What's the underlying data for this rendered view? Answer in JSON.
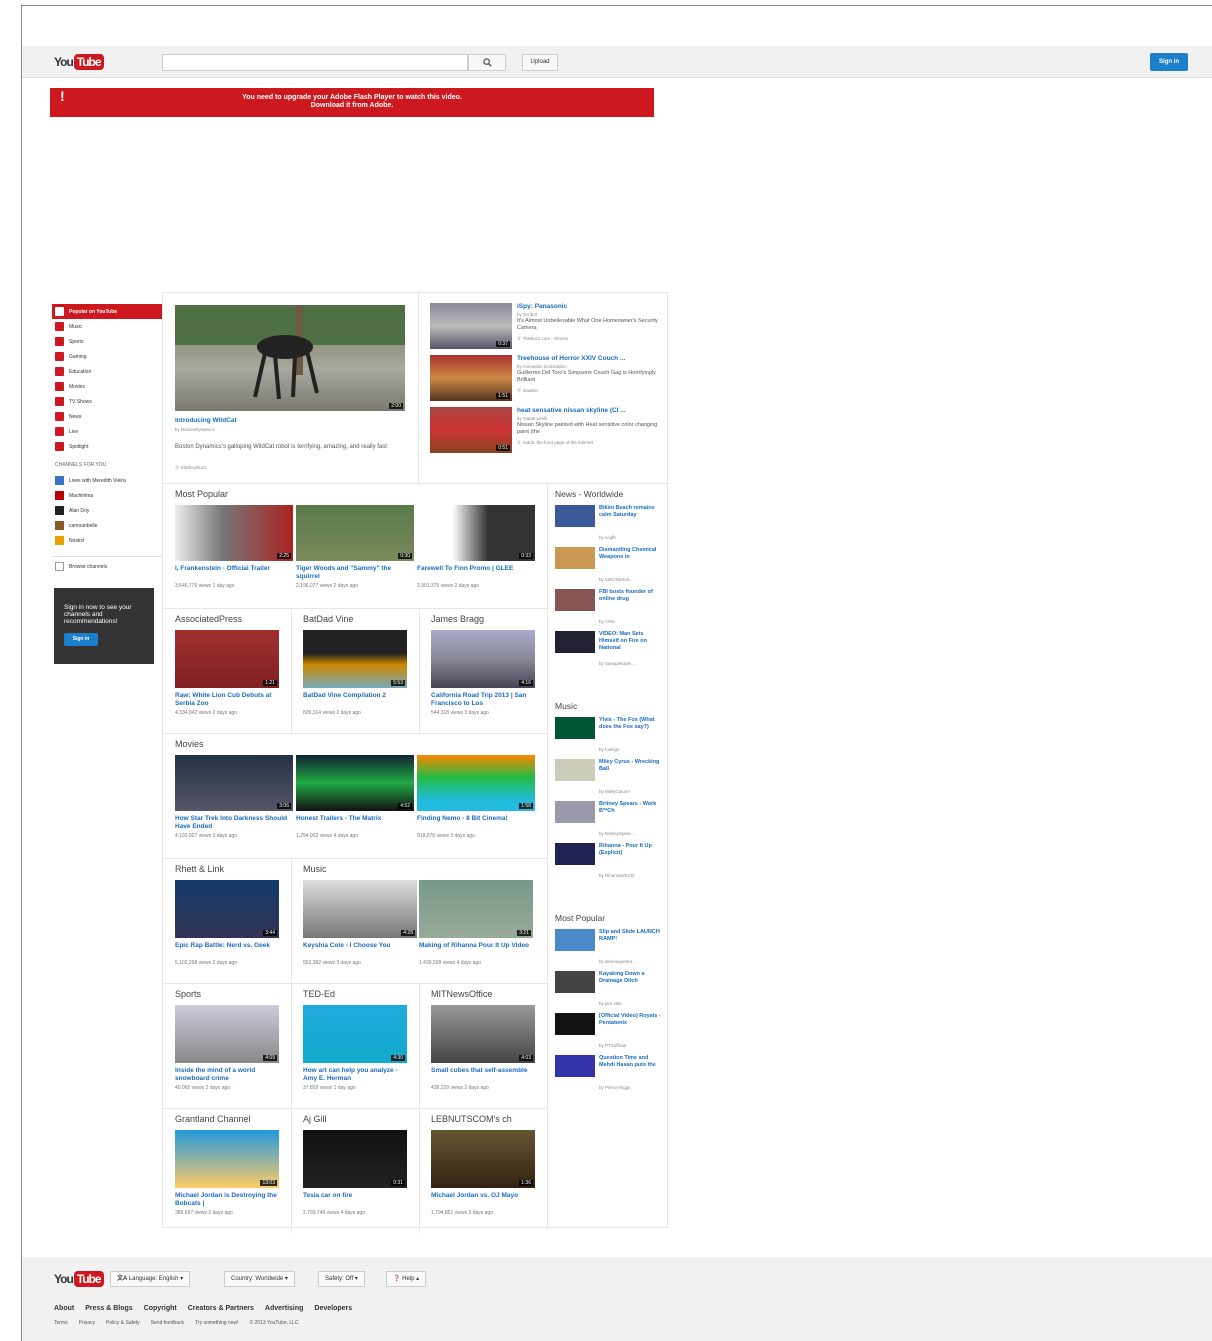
{
  "logo": {
    "you": "You",
    "tube": "Tube"
  },
  "masthead": {
    "search_placeholder": "",
    "upload_label": "Upload",
    "signin_label": "Sign in",
    "search_icon": "magnifier-icon"
  },
  "flash": {
    "line1": "You need to upgrade your Adobe Flash Player to watch this video.",
    "line2": "Download it from Adobe."
  },
  "guide": {
    "items": [
      {
        "label": "Popular on YouTube",
        "active": true
      },
      {
        "label": "Music"
      },
      {
        "label": "Sports"
      },
      {
        "label": "Gaming"
      },
      {
        "label": "Education"
      },
      {
        "label": "Movies"
      },
      {
        "label": "TV Shows"
      },
      {
        "label": "News"
      },
      {
        "label": "Live"
      },
      {
        "label": "Spotlight"
      }
    ],
    "channels_heading": "CHANNELS FOR YOU",
    "channels": [
      {
        "label": "Lives with Meredith Vieira",
        "color": "#3b73c4"
      },
      {
        "label": "Machinima",
        "color": "#b00"
      },
      {
        "label": "Alan Doy",
        "color": "#222"
      },
      {
        "label": "camoanbelle",
        "color": "#8a5a2a"
      },
      {
        "label": "Nostrd",
        "color": "#e8a000"
      }
    ],
    "browse_label": "Browse channels"
  },
  "promo": {
    "text": "Sign in now to see your channels and recommendations!",
    "button": "Sign in"
  },
  "featured": {
    "main": {
      "title": "Introducing WildCat",
      "by": "by BostonDynamics",
      "desc": "Boston Dynamics's galloping WildCat robot is terrifying, amazing, and really fast",
      "note": "Ⓢ StarboyBuzz",
      "dur": "2:00"
    },
    "list": [
      {
        "title": "iSpy: Panasonic",
        "by": "by Scribol",
        "desc": "It's Almost Unbelievable What One Homeowner's Security Camera",
        "note": "Ⓢ TheBuzz.com - Stories",
        "dur": "0:37"
      },
      {
        "title": "Treehouse of Horror XXIV Couch ...",
        "by": "by Animation Domination",
        "desc": "Guillermo Del Toro's Simpsons Couch Gag is Horrifyingly Brilliant",
        "note": "Ⓢ Gawker",
        "dur": "1:51"
      },
      {
        "title": "heat sensative nissan skyline (CI ...",
        "by": "by Gareti pirelli",
        "desc": "Nissan Skyline painted with Heat sensitive color changing paint (the",
        "note": "Ⓢ reddit: the front page of the internet",
        "dur": "0:51"
      }
    ]
  },
  "shelves": [
    {
      "title": "Most Popular",
      "videos": [
        {
          "title": "I, Frankenstein - Official Trailer",
          "meta": "3,646,776 views   1 day ago",
          "dur": "2:25"
        },
        {
          "title": "Tiger Woods and \"Sammy\" the squirrel",
          "meta": "2,196,077 views   2 days ago",
          "dur": "0:30"
        },
        {
          "title": "Farewell To Finn Promo | GLEE",
          "meta": "2,901,375 views   2 days ago",
          "dur": "0:33"
        }
      ]
    },
    {
      "title": "",
      "videos": [
        {
          "channel": "AssociatedPress",
          "title": "Raw: White Lion Cub Debuts at Serbia Zoo",
          "meta": "4,334,042 views   2 days ago",
          "dur": "1:21"
        },
        {
          "channel": "BatDad Vine",
          "title": "BatDad Vine Compilation 2",
          "meta": "826,314 views   2 days ago",
          "dur": "5:53"
        },
        {
          "channel": "James Bragg",
          "title": "California Road Trip 2013 | San Francisco to Los",
          "meta": "544,318 views   3 days ago",
          "dur": "4:16"
        }
      ]
    },
    {
      "title": "Movies",
      "videos": [
        {
          "title": "How Star Trek Into Darkness Should Have Ended",
          "meta": "4,193,507 views   3 days ago",
          "dur": "3:06"
        },
        {
          "title": "Honest Trailers - The Matrix",
          "meta": "1,294,002 views   4 days ago",
          "dur": "4:52"
        },
        {
          "title": "Finding Nemo - 8 Bit Cinema!",
          "meta": "919,076 views   3 days ago",
          "dur": "1:58"
        }
      ]
    },
    {
      "title": "",
      "videos": [
        {
          "channel": "Rhett & Link",
          "title": "Epic Rap Battle: Nerd vs. Geek",
          "meta": "5,102,298 views   2 days ago",
          "dur": "3:44"
        },
        {
          "channel": "Music",
          "title": "Keyshia Cole - I Choose You",
          "meta": "552,382 views   3 days ago",
          "dur": "4:28"
        },
        {
          "channel": "",
          "title": "Making of Rihanna Pour It Up Video",
          "meta": "1,439,598 views   4 days ago",
          "dur": "3:21"
        }
      ]
    },
    {
      "title": "",
      "videos": [
        {
          "channel": "Sports",
          "title": "Inside the mind of a world snowboard crime",
          "meta": "40,065 views   2 days ago",
          "dur": "4:09"
        },
        {
          "channel": "TED-Ed",
          "title": "How art can help you analyze - Amy E. Herman",
          "meta": "37,893 views   1 day ago",
          "dur": "4:30"
        },
        {
          "channel": "MITNewsOffice",
          "title": "Small cubes that self-assemble",
          "meta": "438,229 views   2 days ago",
          "dur": "4:03"
        }
      ]
    },
    {
      "title": "",
      "videos": [
        {
          "channel": "Grantland Channel",
          "title": "Michael Jordan is Destroying the Bobcats |",
          "meta": "386,697 views   2 days ago",
          "dur": "13:03"
        },
        {
          "channel": "Aj Gill",
          "title": "Tesla car on fire",
          "meta": "2,793,746 views   4 days ago",
          "dur": "0:31"
        },
        {
          "channel": "LEBNUTSCOM's ch",
          "title": "Michael Jordan vs. OJ Mayo",
          "meta": "1,794,851 views   3 days ago",
          "dur": "1:36"
        }
      ]
    }
  ],
  "sidebar": {
    "sections": [
      {
        "title": "News - Worldwide",
        "items": [
          {
            "title": "Bikini Beach remains calm Saturday",
            "by": "by vcgfh"
          },
          {
            "title": "Dismantling Chemical Weapons in",
            "by": "by CBC/Netroll..."
          },
          {
            "title": "FBI busts founder of online drug",
            "by": "by CNN"
          },
          {
            "title": "VIDEO: Man Sets Himself on Fire on National",
            "by": "by SavageNade..."
          }
        ]
      },
      {
        "title": "Music",
        "items": [
          {
            "title": "Ylvis - The Fox (What does the Fox say?)",
            "by": "by Ioseign"
          },
          {
            "title": "Miley Cyrus - Wrecking Ball",
            "by": "by MileyCyrusV"
          },
          {
            "title": "Britney Spears - Work B**Ch",
            "by": "by BritneySpear..."
          },
          {
            "title": "Rihanna - Pour It Up (Explicit)",
            "by": "by RihannaVEVO"
          }
        ]
      },
      {
        "title": "Most Popular",
        "items": [
          {
            "title": "Slip and Slide LAUNCH RAMP!",
            "by": "by devinsupertra..."
          },
          {
            "title": "Kayaking Down a Drainage Ditch",
            "by": "by jam vids"
          },
          {
            "title": "[Official Video] Royals - Pentatonix",
            "by": "by PTXofficial"
          },
          {
            "title": "Question Time and Mehdi Hasan puts the",
            "by": "by Pierce Riggs"
          }
        ]
      }
    ]
  },
  "footer": {
    "lang": "Language: English ▾",
    "country": "Country: Worldwide ▾",
    "safety": "Safety: Off ▾",
    "help": "Help ▴",
    "links": [
      "About",
      "Press & Blogs",
      "Copyright",
      "Creators & Partners",
      "Advertising",
      "Developers"
    ],
    "links2": [
      "Terms",
      "Privacy",
      "Policy & Safety",
      "Send feedback",
      "Try something new!",
      "© 2013 YouTube, LLC"
    ]
  }
}
